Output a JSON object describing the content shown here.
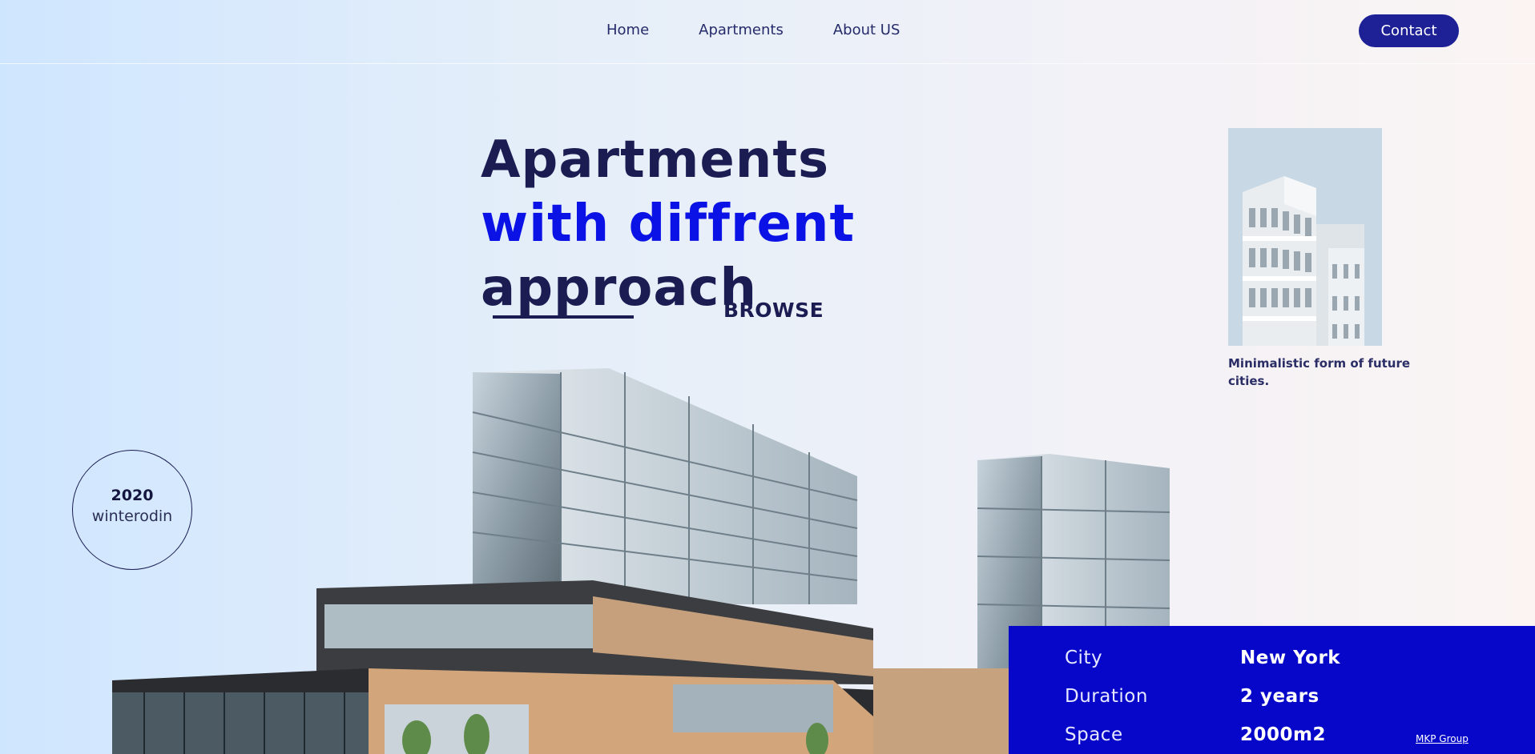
{
  "nav": {
    "links": [
      "Home",
      "Apartments",
      "About US"
    ],
    "contact_label": "Contact"
  },
  "hero": {
    "line1": "Apartments",
    "line2": "with diffrent",
    "line3": "approach",
    "browse_label": "BROWSE"
  },
  "feature": {
    "caption": "Minimalistic form of future cities."
  },
  "badge": {
    "year": "2020",
    "name": "winterodin"
  },
  "info": {
    "rows": [
      {
        "label": "City",
        "value": "New York"
      },
      {
        "label": "Duration",
        "value": "2 years"
      },
      {
        "label": "Space",
        "value": "2000m2"
      }
    ],
    "credit": "MKP Group"
  },
  "colors": {
    "accent": "#1e2196",
    "headline_blue": "#0a12e6",
    "panel_blue": "#0707c9",
    "text_dark": "#1b1d52"
  },
  "icons": [
    "building-illustration",
    "tower-photo"
  ]
}
